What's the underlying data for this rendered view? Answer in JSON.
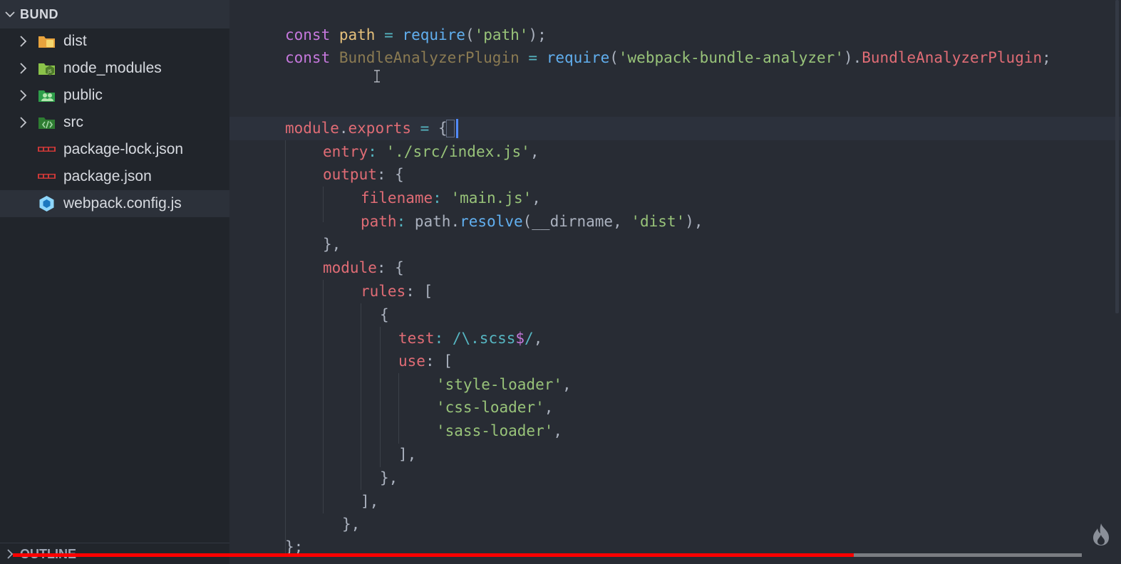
{
  "explorer": {
    "section_title": "BUND",
    "items": [
      {
        "label": "dist",
        "kind": "folder",
        "icon": "folder-dist-icon"
      },
      {
        "label": "node_modules",
        "kind": "folder",
        "icon": "folder-node-icon"
      },
      {
        "label": "public",
        "kind": "folder",
        "icon": "folder-public-icon"
      },
      {
        "label": "src",
        "kind": "folder",
        "icon": "folder-src-icon"
      },
      {
        "label": "package-lock.json",
        "kind": "file",
        "icon": "npm-icon"
      },
      {
        "label": "package.json",
        "kind": "file",
        "icon": "npm-icon"
      },
      {
        "label": "webpack.config.js",
        "kind": "file",
        "icon": "webpack-icon",
        "selected": true
      }
    ],
    "outline_title": "OUTLINE"
  },
  "editor": {
    "line1": {
      "kw": "const",
      "name": "path",
      "eq": "=",
      "fn": "require",
      "open": "(",
      "arg": "'path'",
      "close": ");"
    },
    "line2": {
      "kw": "const",
      "name": "BundleAnalyzerPlugin",
      "eq": "=",
      "fn": "require",
      "open": "(",
      "arg": "'webpack-bundle-analyzer'",
      "close": ").",
      "member": "BundleAnalyzerPlugin",
      "end": ";"
    },
    "line5": {
      "obj": "module",
      "dot": ".",
      "prop": "exports",
      "eq": " = ",
      "brace": "{"
    },
    "line6": {
      "key": "entry",
      "colon": ": ",
      "value": "'./src/index.js'",
      "comma": ","
    },
    "line7": {
      "key": "output",
      "rest": ": {"
    },
    "line8": {
      "key": "filename",
      "colon": ": ",
      "value": "'main.js'",
      "comma": ","
    },
    "line9": {
      "key": "path",
      "colon": ": ",
      "obj": "path",
      "dot": ".",
      "fn": "resolve",
      "open": "(",
      "arg1": "__dirname",
      "sep": ", ",
      "arg2": "'dist'",
      "close": "),"
    },
    "line10": "},",
    "line11": {
      "key": "module",
      "rest": ": {"
    },
    "line12": {
      "key": "rules",
      "rest": ": ["
    },
    "line13": "{",
    "line14": {
      "key": "test",
      "colon": ": ",
      "re1": "/\\.scss",
      "re2": "$",
      "re3": "/",
      "comma": ","
    },
    "line15": {
      "key": "use",
      "rest": ": ["
    },
    "line16": {
      "value": "'style-loader'",
      "comma": ","
    },
    "line17": {
      "value": "'css-loader'",
      "comma": ","
    },
    "line18": {
      "value": "'sass-loader'",
      "comma": ","
    },
    "line19": "],",
    "line20": "},",
    "line21": "],",
    "line22": "},",
    "line23": "};"
  },
  "video": {
    "progress_fraction": 0.787,
    "played_color": "#ff0000",
    "icon": "flame-icon"
  }
}
